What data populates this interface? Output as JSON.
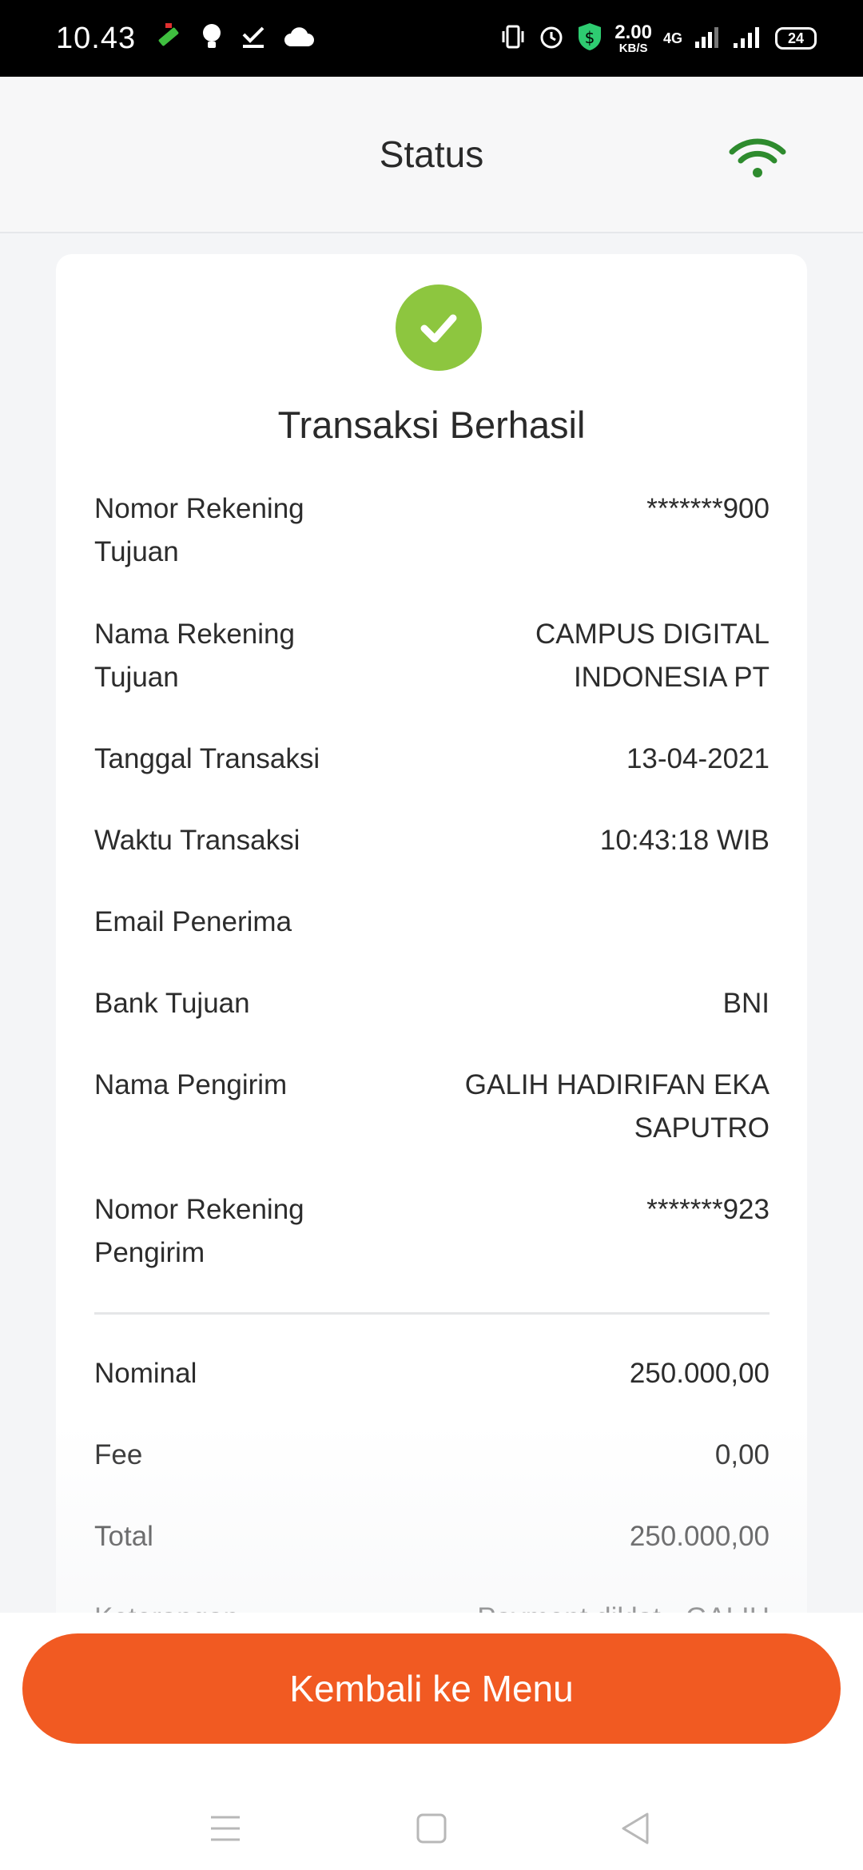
{
  "status_bar": {
    "time": "10.43",
    "speed_value": "2.00",
    "speed_unit": "KB/S",
    "network": "4G",
    "battery": "24"
  },
  "header": {
    "title": "Status"
  },
  "card": {
    "title": "Transaksi Berhasil",
    "details": [
      {
        "label": "Nomor Rekening Tujuan",
        "value": "*******900"
      },
      {
        "label": "Nama Rekening Tujuan",
        "value": "CAMPUS DIGITAL INDONESIA PT"
      },
      {
        "label": "Tanggal Transaksi",
        "value": "13-04-2021"
      },
      {
        "label": "Waktu Transaksi",
        "value": "10:43:18 WIB"
      },
      {
        "label": "Email Penerima",
        "value": ""
      },
      {
        "label": "Bank Tujuan",
        "value": "BNI"
      },
      {
        "label": "Nama Pengirim",
        "value": "GALIH HADIRIFAN EKA SAPUTRO"
      },
      {
        "label": "Nomor Rekening Pengirim",
        "value": "*******923"
      }
    ],
    "totals": [
      {
        "label": "Nominal",
        "value": "250.000,00"
      },
      {
        "label": "Fee",
        "value": "0,00"
      },
      {
        "label": "Total",
        "value": "250.000,00"
      },
      {
        "label": "Keterangan",
        "value": "Payment diklat - GALIH"
      }
    ]
  },
  "actions": {
    "back_to_menu": "Kembali ke Menu"
  },
  "colors": {
    "accent": "#f15a22",
    "success": "#8dc63f",
    "wifi": "#2e8b2e"
  }
}
